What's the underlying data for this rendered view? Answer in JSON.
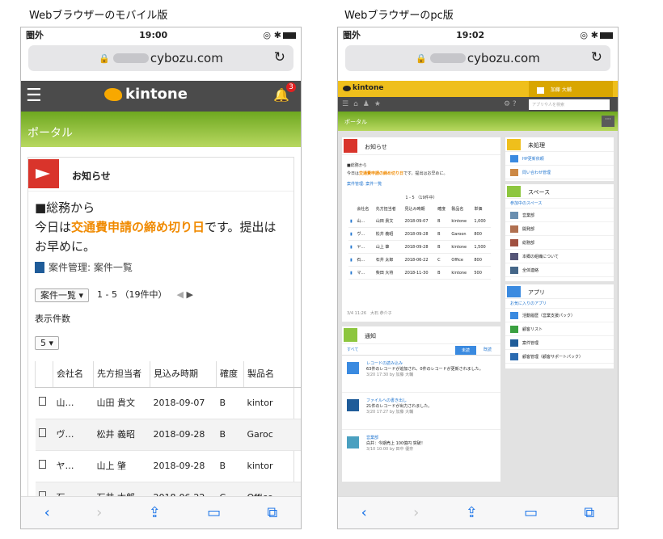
{
  "captions": {
    "mobile": "Webブラウザーのモバイル版",
    "pc": "Webブラウザーのpc版"
  },
  "mobile": {
    "status": {
      "carrier": "圏外",
      "time": "19:00",
      "icons": "◎ ✱"
    },
    "url": "cybozu.com",
    "header": {
      "logo": "kintone",
      "badge": "3"
    },
    "portal": "ポータル",
    "card": {
      "title": "お知らせ",
      "body_line1": "■総務から",
      "body_pre": "今日は",
      "body_highlight": "交通費申請の締め切り日",
      "body_post": "です。提出はお早めに。",
      "app_link": "案件管理: 案件一覧",
      "view_select": "案件一覧",
      "range": "1 - 5 （19件中）",
      "count_label": "表示件数",
      "count_select": "5",
      "columns": [
        "",
        "会社名",
        "先方担当者",
        "見込み時期",
        "確度",
        "製品名"
      ],
      "rows": [
        [
          "",
          "山…",
          "山田 貴文",
          "2018-09-07",
          "B",
          "kintor"
        ],
        [
          "",
          "ヴ…",
          "松井 義昭",
          "2018-09-28",
          "B",
          "Garoc"
        ],
        [
          "",
          "ヤ…",
          "山上 肇",
          "2018-09-28",
          "B",
          "kintor"
        ],
        [
          "",
          "石…",
          "石井 太郎",
          "2018-06-22",
          "C",
          "Office"
        ],
        [
          "",
          "マ…",
          "柴田 大将",
          "2018-11-30",
          "B",
          "kintor"
        ]
      ]
    }
  },
  "pc": {
    "status": {
      "carrier": "圏外",
      "time": "19:02",
      "icons": "◎ ✱"
    },
    "url": "cybozu.com",
    "header": {
      "logo": "kintone",
      "user": "加藤 大輔",
      "search_placeholder": "アプリや人を検索"
    },
    "portal": "ポータル",
    "notice": {
      "title": "お知らせ",
      "line1": "■総務から",
      "pre": "今日は",
      "highlight": "交通費申請の締め切り日",
      "post": "です。提出はお早めに。",
      "app": "案件管理: 案件一覧",
      "range": "1 - 5 （19件中）",
      "columns": [
        "",
        "会社名",
        "先方担当者",
        "見込み時期",
        "確度",
        "製品名",
        "単価"
      ],
      "rows": [
        [
          "",
          "山…",
          "山田 貴文",
          "2018-09-07",
          "B",
          "kintone",
          "1,000"
        ],
        [
          "",
          "ヴ…",
          "松井 義昭",
          "2018-09-28",
          "B",
          "Garoon",
          "800"
        ],
        [
          "",
          "ヤ…",
          "山上 肇",
          "2018-09-28",
          "B",
          "kintone",
          "1,500"
        ],
        [
          "",
          "石…",
          "石井 太郎",
          "2018-06-22",
          "C",
          "Office",
          "800"
        ],
        [
          "",
          "マ…",
          "柴田 大将",
          "2018-11-30",
          "B",
          "kintone",
          "500"
        ]
      ],
      "footer": "3/4 11:26　大石 恭介子"
    },
    "notifications": {
      "title": "通知",
      "filter": "すべて",
      "tab_unread": "未読",
      "tab_read": "既読",
      "items": [
        {
          "title": "レコードの読み込み",
          "line": "63件のレコードが追加され、0件のレコードが更新されました。",
          "meta": "3/20 17:30 by 加藤 大輔"
        },
        {
          "title": "ファイルへの書き出し",
          "line": "21件のレコードが出力されました。",
          "meta": "3/20 17:27 by 加藤 大輔"
        },
        {
          "title": "営業部",
          "line": "白井：今期売上 100億円 突破！",
          "meta": "3/10 10:00 by 田中 優奈"
        }
      ]
    },
    "todo": {
      "title": "未処理",
      "items": [
        "HP更新依頼",
        "問い合わせ管理"
      ]
    },
    "spaces": {
      "title": "スペース",
      "subtitle": "参加中のスペース",
      "items": [
        "営業部",
        "開発部",
        "総務部",
        "本郷の組織について",
        "全体連絡"
      ]
    },
    "apps": {
      "title": "アプリ",
      "subtitle": "お気に入りのアプリ",
      "items": [
        "活動履歴（営業支援パック）",
        "顧客リスト",
        "案件管理",
        "顧客管理（顧客サポートパック）"
      ]
    }
  }
}
